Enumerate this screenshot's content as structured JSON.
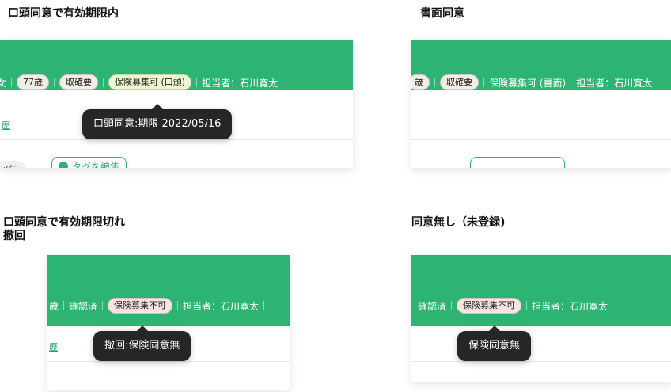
{
  "sections": {
    "top_left": {
      "heading": "口頭同意で有効期限内",
      "row": {
        "edge_char": "女",
        "age": "77歳",
        "status": "取確要",
        "consent": "保険募集可 (口頭)",
        "person": "担当者：石川寛太"
      },
      "link": "歴",
      "tooltip": "口頭同意:期限 2022/05/16",
      "partial_chip": "ア先",
      "tag_button": "タグを編集"
    },
    "top_right": {
      "heading": "書面同意",
      "row": {
        "edge_char": "歳",
        "status": "取確要",
        "consent": "保険募集可 (書面)",
        "person": "担当者：石川寛太"
      }
    },
    "bottom_left": {
      "heading_line1": "口頭同意で有効期限切れ",
      "heading_line2": "撤回",
      "row": {
        "edge_char": "歳",
        "status": "確認済",
        "consent": "保険募集不可",
        "person": "担当者：石川寛太"
      },
      "link": "歴",
      "tooltip": "撤回:保険同意無"
    },
    "bottom_right": {
      "heading": "同意無し（未登録)",
      "row": {
        "status": "確認済",
        "consent": "保険募集不可",
        "person": "担当者：石川寛太"
      },
      "tooltip": "保険同意無"
    }
  },
  "colors": {
    "header_green": "#2eb472",
    "tooltip_bg": "#262626",
    "pill_yellow": "#eef6cf",
    "pill_pink": "#f6e4e4"
  }
}
